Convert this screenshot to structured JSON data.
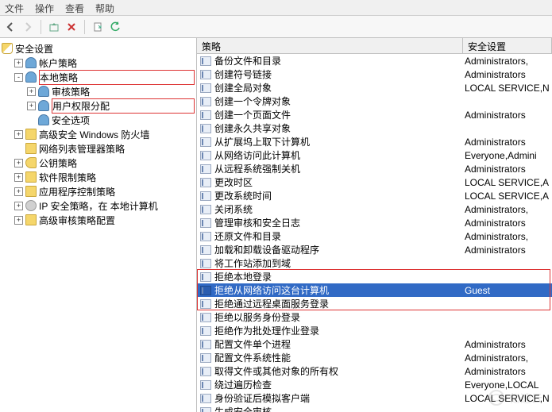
{
  "menu": {
    "file": "文件",
    "ops": "操作",
    "view": "查看",
    "help": "帮助"
  },
  "tree": {
    "root": "安全设置",
    "nodes": [
      {
        "indent": 1,
        "exp": "+",
        "icon": "users",
        "label": "帐户策略"
      },
      {
        "indent": 1,
        "exp": "-",
        "icon": "users",
        "label": "本地策略",
        "hl": true
      },
      {
        "indent": 2,
        "exp": "+",
        "icon": "users",
        "label": "审核策略"
      },
      {
        "indent": 2,
        "exp": "+",
        "icon": "users",
        "label": "用户权限分配",
        "hl": true
      },
      {
        "indent": 2,
        "exp": "",
        "icon": "users",
        "label": "安全选项"
      },
      {
        "indent": 1,
        "exp": "+",
        "icon": "folder",
        "label": "高级安全 Windows 防火墙"
      },
      {
        "indent": 1,
        "exp": "",
        "icon": "folder",
        "label": "网络列表管理器策略"
      },
      {
        "indent": 1,
        "exp": "+",
        "icon": "key",
        "label": "公钥策略"
      },
      {
        "indent": 1,
        "exp": "+",
        "icon": "folder",
        "label": "软件限制策略"
      },
      {
        "indent": 1,
        "exp": "+",
        "icon": "folder",
        "label": "应用程序控制策略"
      },
      {
        "indent": 1,
        "exp": "+",
        "icon": "gear",
        "label": "IP 安全策略，在 本地计算机"
      },
      {
        "indent": 1,
        "exp": "+",
        "icon": "folder",
        "label": "高级审核策略配置"
      }
    ]
  },
  "list": {
    "headers": {
      "policy": "策略",
      "security": "安全设置"
    },
    "rows": [
      {
        "p": "备份文件和目录",
        "s": "Administrators,"
      },
      {
        "p": "创建符号链接",
        "s": "Administrators"
      },
      {
        "p": "创建全局对象",
        "s": "LOCAL SERVICE,N"
      },
      {
        "p": "创建一个令牌对象",
        "s": ""
      },
      {
        "p": "创建一个页面文件",
        "s": "Administrators"
      },
      {
        "p": "创建永久共享对象",
        "s": ""
      },
      {
        "p": "从扩展坞上取下计算机",
        "s": "Administrators"
      },
      {
        "p": "从网络访问此计算机",
        "s": "Everyone,Admini"
      },
      {
        "p": "从远程系统强制关机",
        "s": "Administrators"
      },
      {
        "p": "更改时区",
        "s": "LOCAL SERVICE,A"
      },
      {
        "p": "更改系统时间",
        "s": "LOCAL SERVICE,A"
      },
      {
        "p": "关闭系统",
        "s": "Administrators,"
      },
      {
        "p": "管理审核和安全日志",
        "s": "Administrators"
      },
      {
        "p": "还原文件和目录",
        "s": "Administrators,"
      },
      {
        "p": "加载和卸载设备驱动程序",
        "s": "Administrators"
      },
      {
        "p": "将工作站添加到域",
        "s": ""
      },
      {
        "p": "拒绝本地登录",
        "s": ""
      },
      {
        "p": "拒绝从网络访问这台计算机",
        "s": "Guest",
        "selected": true
      },
      {
        "p": "拒绝通过远程桌面服务登录",
        "s": ""
      },
      {
        "p": "拒绝以服务身份登录",
        "s": ""
      },
      {
        "p": "拒绝作为批处理作业登录",
        "s": ""
      },
      {
        "p": "配置文件单个进程",
        "s": "Administrators"
      },
      {
        "p": "配置文件系统性能",
        "s": "Administrators,"
      },
      {
        "p": "取得文件或其他对象的所有权",
        "s": "Administrators"
      },
      {
        "p": "绕过遍历检查",
        "s": "Everyone,LOCAL"
      },
      {
        "p": "身份验证后模拟客户端",
        "s": "LOCAL SERVICE,N"
      },
      {
        "p": "生成安全审核",
        "s": ""
      }
    ]
  },
  "watermark": "亿速云"
}
